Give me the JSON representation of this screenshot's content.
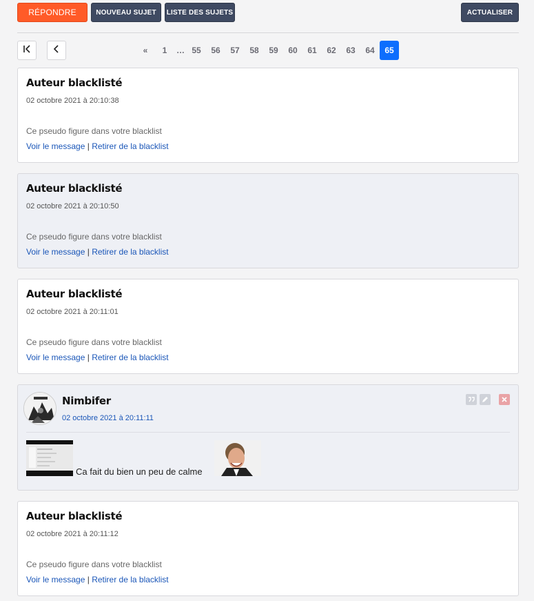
{
  "toolbar": {
    "reply_label": "RÉPONDRE",
    "new_topic_label": "NOUVEAU SUJET",
    "topics_list_label": "LISTE DES SUJETS",
    "refresh_label": "ACTUALISER"
  },
  "pagination": {
    "first_icon": "first-page-icon",
    "prev_icon": "chevron-left-icon",
    "first_marker": "«",
    "page_first": "1",
    "ellipsis": "…",
    "pages": [
      "55",
      "56",
      "57",
      "58",
      "59",
      "60",
      "61",
      "62",
      "63",
      "64"
    ],
    "current": "65"
  },
  "posts": [
    {
      "author": "Auteur blacklisté",
      "date": "02 octobre 2021 à 20:10:38",
      "note": "Ce pseudo figure dans votre blacklist",
      "view_link": "Voir le message",
      "link_sep": "|",
      "remove_link": "Retirer de la blacklist"
    },
    {
      "author": "Auteur blacklisté",
      "date": "02 octobre 2021 à 20:10:50",
      "note": "Ce pseudo figure dans votre blacklist",
      "view_link": "Voir le message",
      "link_sep": "|",
      "remove_link": "Retirer de la blacklist"
    },
    {
      "author": "Auteur blacklisté",
      "date": "02 octobre 2021 à 20:11:01",
      "note": "Ce pseudo figure dans votre blacklist",
      "view_link": "Voir le message",
      "link_sep": "|",
      "remove_link": "Retirer de la blacklist"
    },
    {
      "author": "Nimbifer",
      "date": "02 octobre 2021 à 20:11:11",
      "message": "Ca fait du bien un peu de calme",
      "icons": [
        "quote-icon",
        "edit-icon",
        "delete-icon"
      ]
    },
    {
      "author": "Auteur blacklisté",
      "date": "02 octobre 2021 à 20:11:12",
      "note": "Ce pseudo figure dans votre blacklist",
      "view_link": "Voir le message",
      "link_sep": "|",
      "remove_link": "Retirer de la blacklist"
    }
  ],
  "colors": {
    "reply_button": "#ff5b28",
    "dark_button": "#3f4a62",
    "active_page": "#0d6efd",
    "link": "#1a56b8",
    "delete_icon": "#e9a3a6"
  }
}
